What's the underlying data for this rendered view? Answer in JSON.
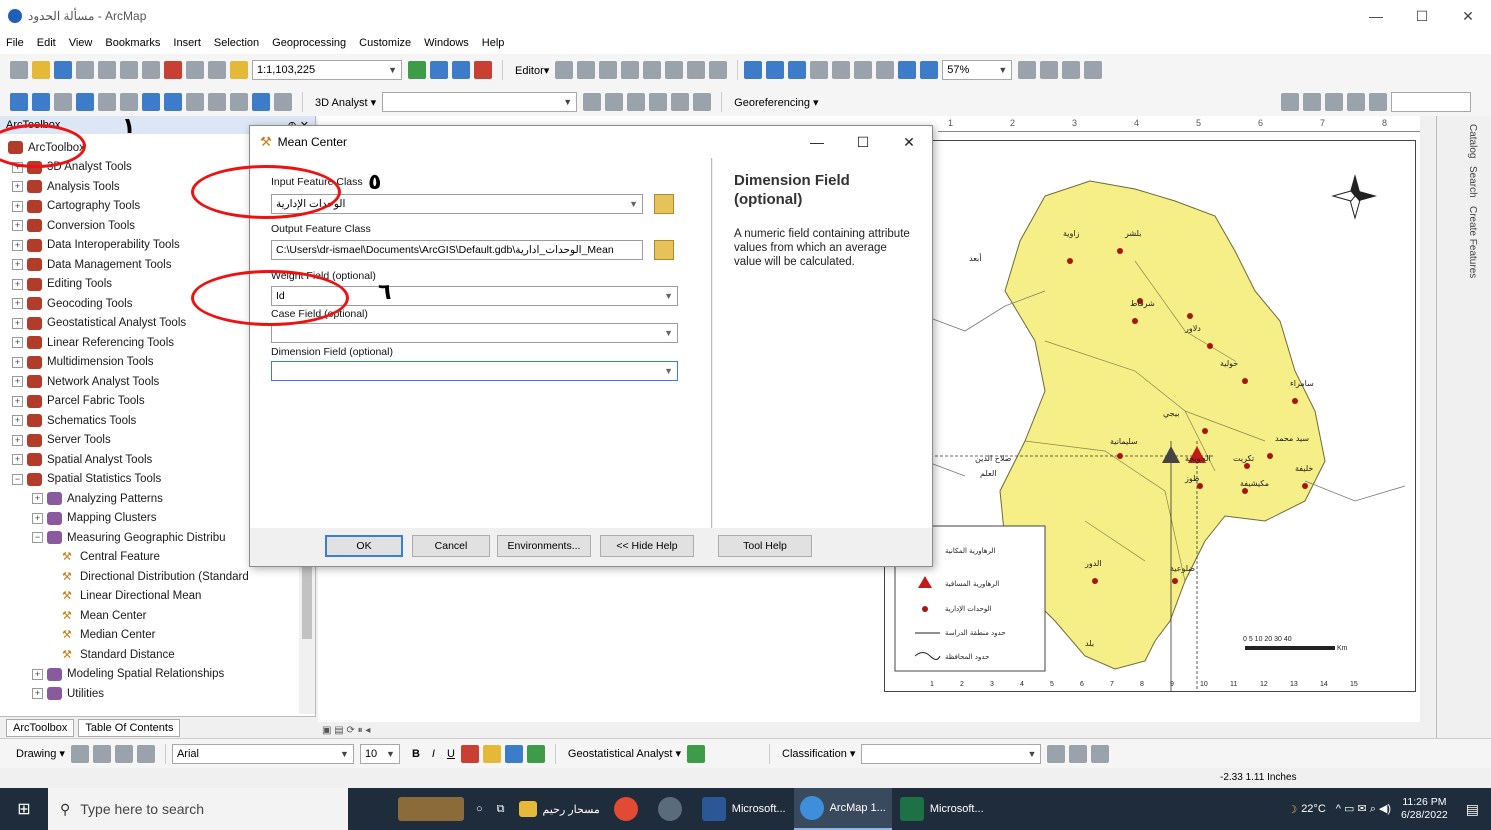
{
  "window": {
    "title": "مسألة الحدود - ArcMap",
    "minimize": "—",
    "maximize": "☐",
    "close": "✕"
  },
  "menu": [
    "File",
    "Edit",
    "View",
    "Bookmarks",
    "Insert",
    "Selection",
    "Geoprocessing",
    "Customize",
    "Windows",
    "Help"
  ],
  "toolbar1": {
    "scale": "1:1,103,225",
    "editor": "Editor▾",
    "zoom": "57%"
  },
  "toolbar2": {
    "analyst3d": "3D Analyst ▾",
    "georef": "Georeferencing ▾"
  },
  "toolbox": {
    "header": "ArcToolbox",
    "header_ctrl": "⊕ ✕",
    "items": [
      {
        "label": "ArcToolbox",
        "expander": "",
        "icon": "toolbox"
      },
      {
        "label": "3D Analyst Tools",
        "expander": "+",
        "icon": "toolbox"
      },
      {
        "label": "Analysis Tools",
        "expander": "+",
        "icon": "toolbox"
      },
      {
        "label": "Cartography Tools",
        "expander": "+",
        "icon": "toolbox"
      },
      {
        "label": "Conversion Tools",
        "expander": "+",
        "icon": "toolbox"
      },
      {
        "label": "Data Interoperability Tools",
        "expander": "+",
        "icon": "toolbox"
      },
      {
        "label": "Data Management Tools",
        "expander": "+",
        "icon": "toolbox"
      },
      {
        "label": "Editing Tools",
        "expander": "+",
        "icon": "toolbox"
      },
      {
        "label": "Geocoding Tools",
        "expander": "+",
        "icon": "toolbox"
      },
      {
        "label": "Geostatistical Analyst Tools",
        "expander": "+",
        "icon": "toolbox"
      },
      {
        "label": "Linear Referencing Tools",
        "expander": "+",
        "icon": "toolbox"
      },
      {
        "label": "Multidimension Tools",
        "expander": "+",
        "icon": "toolbox"
      },
      {
        "label": "Network Analyst Tools",
        "expander": "+",
        "icon": "toolbox"
      },
      {
        "label": "Parcel Fabric Tools",
        "expander": "+",
        "icon": "toolbox"
      },
      {
        "label": "Schematics Tools",
        "expander": "+",
        "icon": "toolbox"
      },
      {
        "label": "Server Tools",
        "expander": "+",
        "icon": "toolbox"
      },
      {
        "label": "Spatial Analyst Tools",
        "expander": "+",
        "icon": "toolbox"
      },
      {
        "label": "Spatial Statistics Tools",
        "expander": "−",
        "icon": "toolbox"
      },
      {
        "label": "Analyzing Patterns",
        "expander": "+",
        "icon": "toolset"
      },
      {
        "label": "Mapping Clusters",
        "expander": "+",
        "icon": "toolset"
      },
      {
        "label": "Measuring Geographic Distribu",
        "expander": "−",
        "icon": "toolset"
      },
      {
        "label": "Central Feature",
        "expander": "",
        "icon": "tool"
      },
      {
        "label": "Directional Distribution (Standard",
        "expander": "",
        "icon": "tool"
      },
      {
        "label": "Linear Directional Mean",
        "expander": "",
        "icon": "tool"
      },
      {
        "label": "Mean Center",
        "expander": "",
        "icon": "tool"
      },
      {
        "label": "Median Center",
        "expander": "",
        "icon": "tool"
      },
      {
        "label": "Standard Distance",
        "expander": "",
        "icon": "tool"
      },
      {
        "label": "Modeling Spatial Relationships",
        "expander": "+",
        "icon": "toolset"
      },
      {
        "label": "Utilities",
        "expander": "+",
        "icon": "toolset"
      }
    ],
    "tabs": [
      "ArcToolbox",
      "Table Of Contents"
    ]
  },
  "dialog": {
    "title": "Mean Center",
    "input_label": "Input Feature Class",
    "input_value": "الوحدات الإدارية",
    "output_label": "Output Feature Class",
    "output_value": "C:\\Users\\dr-ismael\\Documents\\ArcGIS\\Default.gdb\\الوحدات_ادارية_Mean",
    "weight_label": "Weight Field (optional)",
    "weight_value": "Id",
    "case_label": "Case Field (optional)",
    "case_value": "",
    "dimension_label": "Dimension Field (optional)",
    "dimension_value": "",
    "help_title": "Dimension Field (optional)",
    "help_text": "A numeric field containing attribute values from which an average value will be calculated.",
    "buttons": {
      "ok": "OK",
      "cancel": "Cancel",
      "env": "Environments...",
      "hide_help": "<< Hide Help",
      "tool_help": "Tool Help"
    }
  },
  "annotations": {
    "n1": "١",
    "n5": "٥",
    "n6": "٦"
  },
  "map": {
    "labels": [
      "بلشر",
      "زاوية",
      "أبعد",
      "شرقاط",
      "دلاور",
      "خولية",
      "سامراء",
      "بيجي",
      "سليمانية",
      "صلاح الدين",
      "سيد محمد",
      "الحويجة",
      "خليفة",
      "تكريت",
      "مكيشيفة",
      "طوز",
      "الدور",
      "ضلوعية",
      "بلد",
      "العلم"
    ],
    "legend": [
      "الرهاورية المكانية",
      "الرهاورية المسافية",
      "الوحدات الإدارية",
      "حدود منطقة الدراسة",
      "حدود المحافظة"
    ],
    "ruler": [
      "1",
      "2",
      "3",
      "4",
      "5",
      "6",
      "7",
      "8"
    ],
    "scale_text": "Km",
    "scale_nums": "0  5  10  20  30  40",
    "bottom_nums": [
      "1",
      "2",
      "3",
      "4",
      "5",
      "6",
      "7",
      "8",
      "9",
      "10",
      "11",
      "12",
      "13",
      "14",
      "15"
    ]
  },
  "dock_right": [
    "Catalog",
    "Search",
    "Create Features"
  ],
  "drawbar": {
    "drawing": "Drawing ▾",
    "font": "Arial",
    "size": "10",
    "geostat": "Geostatistical Analyst ▾",
    "classification": "Classification ▾"
  },
  "status": {
    "coords": "-2.33  1.11 Inches"
  },
  "taskbar": {
    "search_placeholder": "Type here to search",
    "apps": [
      "مسحار رحيم",
      "Microsoft...",
      "ArcMap 1...",
      "Microsoft..."
    ],
    "weather": "22°C",
    "time": "11:26 PM",
    "date": "6/28/2022"
  },
  "colors": {
    "map_fill": "#f6ee86",
    "annotation_red": "#e11111",
    "accent": "#3b7fd1"
  }
}
